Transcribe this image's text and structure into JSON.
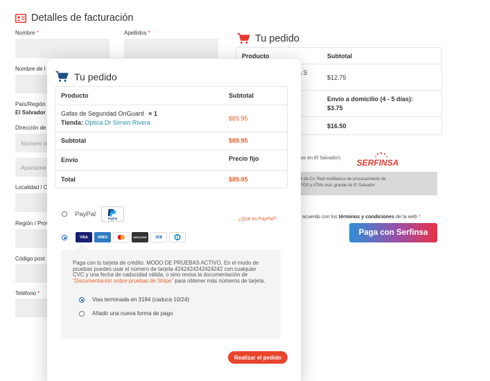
{
  "billing": {
    "title": "Detalles de facturación",
    "fields": {
      "nombre": "Nombre",
      "apellidos": "Apellidos",
      "nombre_empresa": "Nombre de l",
      "pais": "País/Región",
      "pais_value": "El Salvador",
      "direccion": "Dirección de",
      "direccion_placeholder": "Número de",
      "apartamento_placeholder": "Apartame",
      "localidad": "Localidad / C",
      "region": "Región / Prov",
      "codigo_postal": "Código post",
      "telefono": "Teléfono"
    },
    "required_mark": "*"
  },
  "background_order": {
    "title": "Tu pedido",
    "header_product": "Producto",
    "header_subtotal": "Subtotal",
    "row1_product_fragment": "a S",
    "row1_price": "$12.75",
    "shipping_label": "Envío a domicilio (4 - 5 días):",
    "shipping_price": "$3.75",
    "total_price": "$16.50",
    "serfinsa_note": "os en El Salvador)",
    "serfinsa_brand": "SERFINSA",
    "serfinsa_info_line1": "A de Cv; Red multibanco de procesamiento de",
    "serfinsa_info_line2": "POS y ATMs más grande de El Salvador",
    "terms_prefix": "acuerdo con los",
    "terms_link": "términos y condiciones",
    "terms_suffix": "de la web",
    "terms_star": "*",
    "serfinsa_button": "Paga con Serfinsa"
  },
  "checkout": {
    "title": "Tu pedido",
    "header_product": "Producto",
    "header_subtotal": "Subtotal",
    "item_name": "Gafas de Seguridad OnGuard",
    "item_qty": "× 1",
    "store_label": "Tienda:",
    "store_name": "Optica Dr Simon Rivera",
    "item_price": "$89.95",
    "subtotal_label": "Subtotal",
    "subtotal_value": "$89.95",
    "shipping_label": "Envío",
    "shipping_value": "Precio fijo",
    "total_label": "Total",
    "total_value": "$89.95",
    "paypal_label": "PayPal",
    "paypal_badge": "PayPal",
    "paypal_what": "¿Qué es PayPal?",
    "card_brands": [
      "VISA",
      "AMEX",
      "MC",
      "DISCOVER",
      "JCB",
      "DINERS"
    ],
    "stripe_text_1": "Paga con tu tarjeta de crédito. MODO DE PRUEBAS ACTIVO. En el modo de pruebas puedes usar el número de tarjeta 4242424242424242 con cualquier CVC y una fecha de caducidad válida, o sino revisa la documentación de",
    "stripe_doc_link": "\"Documentación sobre pruebas de Stripe\"",
    "stripe_text_2": "para obtener más números de tarjeta.",
    "saved_card": "Visa terminada en 3184 (caduca 10/24)",
    "new_card": "Añadir una nueva forma de pago",
    "place_order": "Realizar el pedido"
  },
  "colors": {
    "accent_red": "#e43a2f",
    "price_orange": "#e4602f",
    "link_teal": "#2a8fb0",
    "radio_blue": "#2266bb"
  },
  "icons": [
    "id-card-icon",
    "cart-icon",
    "serfinsa-logo",
    "paypal-logo",
    "visa-icon",
    "amex-icon",
    "mastercard-icon",
    "discover-icon",
    "jcb-icon",
    "diners-icon"
  ]
}
